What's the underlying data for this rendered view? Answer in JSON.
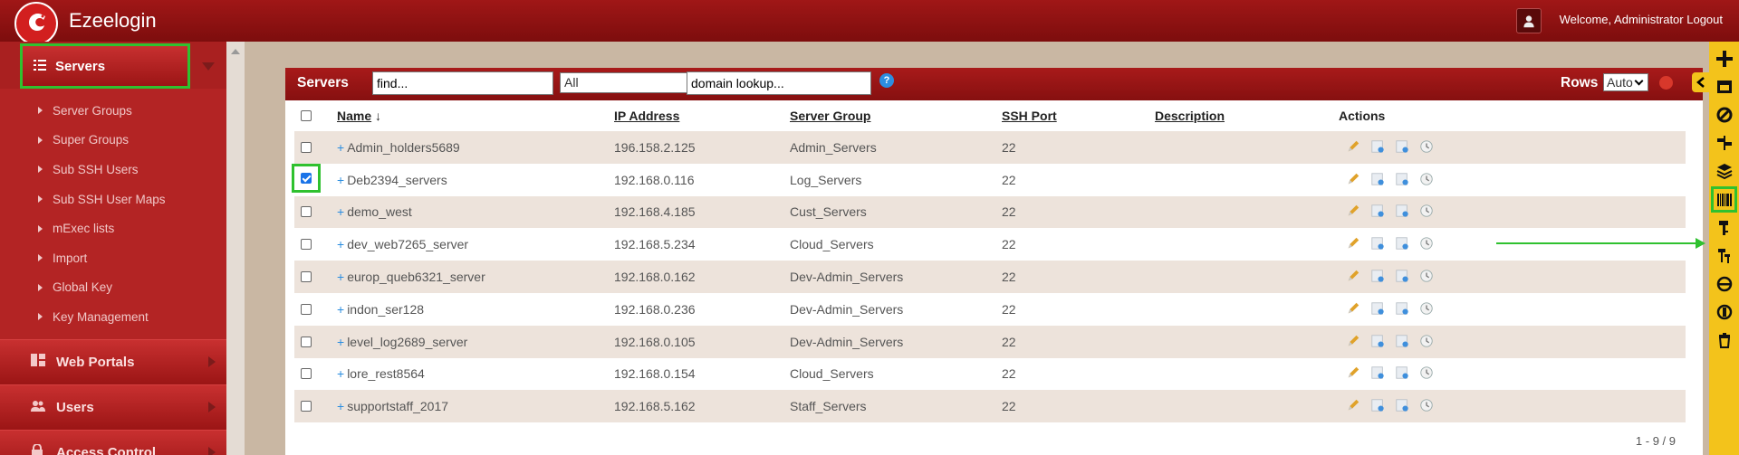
{
  "app": {
    "brand": "Ezeelogin",
    "welcome_text": "Welcome, Administrator Logout"
  },
  "sidebar": {
    "main_label": "Servers",
    "sub_items": [
      "Server Groups",
      "Super Groups",
      "Sub SSH Users",
      "Sub SSH User Maps",
      "mExec lists",
      "Import",
      "Global Key",
      "Key Management"
    ],
    "sections": [
      "Web Portals",
      "Users",
      "Access Control"
    ]
  },
  "panel": {
    "title": "Servers",
    "find_value": "find...",
    "group_filter": "All",
    "domain_value": "domain lookup...",
    "help_glyph": "?",
    "rows_label": "Rows",
    "rows_value": "Auto",
    "pagination": "1 - 9 / 9"
  },
  "table": {
    "headers": {
      "name": "Name",
      "ip": "IP Address",
      "group": "Server Group",
      "port": "SSH Port",
      "description": "Description",
      "actions": "Actions"
    },
    "rows": [
      {
        "name": "Admin_holders5689",
        "ip": "196.158.2.125",
        "group": "Admin_Servers",
        "port": "22",
        "checked": false
      },
      {
        "name": "Deb2394_servers",
        "ip": "192.168.0.116",
        "group": "Log_Servers",
        "port": "22",
        "checked": true
      },
      {
        "name": "demo_west",
        "ip": "192.168.4.185",
        "group": "Cust_Servers",
        "port": "22",
        "checked": false
      },
      {
        "name": "dev_web7265_server",
        "ip": "192.168.5.234",
        "group": "Cloud_Servers",
        "port": "22",
        "checked": false
      },
      {
        "name": "europ_queb6321_server",
        "ip": "192.168.0.162",
        "group": "Dev-Admin_Servers",
        "port": "22",
        "checked": false
      },
      {
        "name": "indon_ser128",
        "ip": "192.168.0.236",
        "group": "Dev-Admin_Servers",
        "port": "22",
        "checked": false
      },
      {
        "name": "level_log2689_server",
        "ip": "192.168.0.105",
        "group": "Dev-Admin_Servers",
        "port": "22",
        "checked": false
      },
      {
        "name": "lore_rest8564",
        "ip": "192.168.0.154",
        "group": "Cloud_Servers",
        "port": "22",
        "checked": false
      },
      {
        "name": "supportstaff_2017",
        "ip": "192.168.5.162",
        "group": "Staff_Servers",
        "port": "22",
        "checked": false
      }
    ]
  },
  "toolbar_icons": [
    "plus-icon",
    "window-icon",
    "ban-icon",
    "signpost-icon",
    "layers-icon",
    "barcode-icon",
    "key-icon",
    "keys-icon",
    "chain-icon",
    "globe-lock-icon",
    "trash-icon"
  ],
  "colors": {
    "header_red": "#a01717",
    "toolbar_yellow": "#f3c31b",
    "highlight_green": "#2fc12f",
    "link_blue": "#2c8ee0"
  }
}
